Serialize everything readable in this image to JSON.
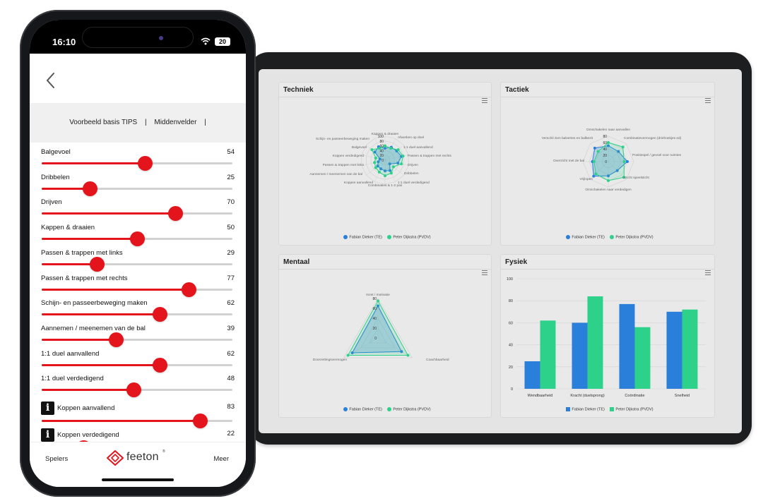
{
  "phone": {
    "status": {
      "time": "16:10",
      "battery": "20"
    },
    "breadcrumb": [
      "Voorbeeld basis TIPS",
      "|",
      "Middenvelder",
      "|"
    ],
    "skills": [
      {
        "label": "Balgevoel",
        "value": "54",
        "percent": 54
      },
      {
        "label": "Dribbelen",
        "value": "25",
        "percent": 25
      },
      {
        "label": "Drijven",
        "value": "70",
        "percent": 70
      },
      {
        "label": "Kappen & draaien",
        "value": "50",
        "percent": 50
      },
      {
        "label": "Passen & trappen met links",
        "value": "29",
        "percent": 29
      },
      {
        "label": "Passen & trappen met rechts",
        "value": "77",
        "percent": 77
      },
      {
        "label": "Schijn- en passeerbeweging maken",
        "value": "62",
        "percent": 62
      },
      {
        "label": "Aannemen / meenemen van de bal",
        "value": "39",
        "percent": 39
      },
      {
        "label": "1:1 duel aanvallend",
        "value": "62",
        "percent": 62
      },
      {
        "label": "1:1 duel verdedigend",
        "value": "48",
        "percent": 48
      },
      {
        "label": "Koppen aanvallend",
        "value": "83",
        "percent": 83,
        "info": true
      },
      {
        "label": "Koppen verdedigend",
        "value": "22",
        "percent": 22,
        "info": true
      }
    ],
    "tabbar": {
      "left": "Spelers",
      "logo": "feeton",
      "logo_mark": "®",
      "right": "Meer"
    }
  },
  "colors": {
    "accent_red": "#e3141b",
    "blue": "#2a7fdb",
    "green": "#2ed18a"
  },
  "dashboard": {
    "legend": [
      "Fabian Dieker (TE)",
      "Peter Dijkstra (PVDV)"
    ],
    "techniek": {
      "title": "Techniek",
      "chart_data": {
        "type": "radar",
        "axes": [
          "Kappen & draaien",
          "Afwerken op doel",
          "1:1 duel aanvallend",
          "Passen & trappen met rechts",
          "Drijven",
          "Dribbelen",
          "1:1 duel verdedigend",
          "Combinaties & 1-2 pas",
          "Koppen aanvallend",
          "Aannemen / meenemen van de bal",
          "Passen & trappen met links",
          "Koppen verdedigend",
          "Balgevoel",
          "Schijn- en passeerbeweging maken"
        ],
        "ticks": [
          "100",
          "80",
          "60",
          "40",
          "20",
          "0"
        ],
        "series": [
          {
            "name": "Fabian Dieker (TE)",
            "values": [
              50,
              60,
              62,
              70,
              55,
              25,
              48,
              45,
              40,
              39,
              29,
              22,
              54,
              62
            ]
          },
          {
            "name": "Peter Dijkstra (PVDV)",
            "values": [
              60,
              55,
              70,
              77,
              70,
              45,
              60,
              65,
              55,
              50,
              45,
              40,
              70,
              55
            ]
          }
        ]
      }
    },
    "tactiek": {
      "title": "Tactiek",
      "chart_data": {
        "type": "radar",
        "axes": [
          "Omschakelen naar aanvallen",
          "Combinatievermogen (driehoekjes ed)",
          "Positiespel / gevoel voor ruimtes",
          "Inzicht speelsticht",
          "Omschakelen naar verdedigen",
          "Vrijlopen",
          "Overzicht met de bal",
          "Verschil zien balvertes en balbezit"
        ],
        "ticks": [
          "80",
          "60",
          "40",
          "20",
          "0"
        ],
        "series": [
          {
            "name": "Fabian Dieker (TE)",
            "values": [
              50,
              45,
              60,
              40,
              45,
              65,
              50,
              60
            ]
          },
          {
            "name": "Peter Dijkstra (PVDV)",
            "values": [
              60,
              65,
              50,
              70,
              60,
              55,
              45,
              45
            ]
          }
        ]
      }
    },
    "mentaal": {
      "title": "Mentaal",
      "chart_data": {
        "type": "radar",
        "axes": [
          "Inzet / motivatie",
          "Coachbaarheid",
          "Doorzettingsvermogen"
        ],
        "ticks": [
          "80",
          "60",
          "40",
          "20",
          "0"
        ],
        "series": [
          {
            "name": "Fabian Dieker (TE)",
            "values": [
              65,
              55,
              60
            ]
          },
          {
            "name": "Peter Dijkstra (PVDV)",
            "values": [
              75,
              70,
              70
            ]
          }
        ]
      }
    },
    "fysiek": {
      "title": "Fysiek",
      "chart_data": {
        "type": "bar",
        "categories": [
          "Wendbaarheid",
          "Kracht (duelsprong)",
          "Coördinatie",
          "Snelheid"
        ],
        "series": [
          {
            "name": "Fabian Dieker (TE)",
            "values": [
              25,
              60,
              77,
              70
            ]
          },
          {
            "name": "Peter Dijkstra (PVDV)",
            "values": [
              62,
              84,
              56,
              72
            ]
          }
        ],
        "yticks": [
          "100",
          "80",
          "60",
          "40",
          "20",
          "0"
        ],
        "ylim": [
          0,
          100
        ],
        "grid": true,
        "legend_position": "bottom"
      }
    }
  }
}
